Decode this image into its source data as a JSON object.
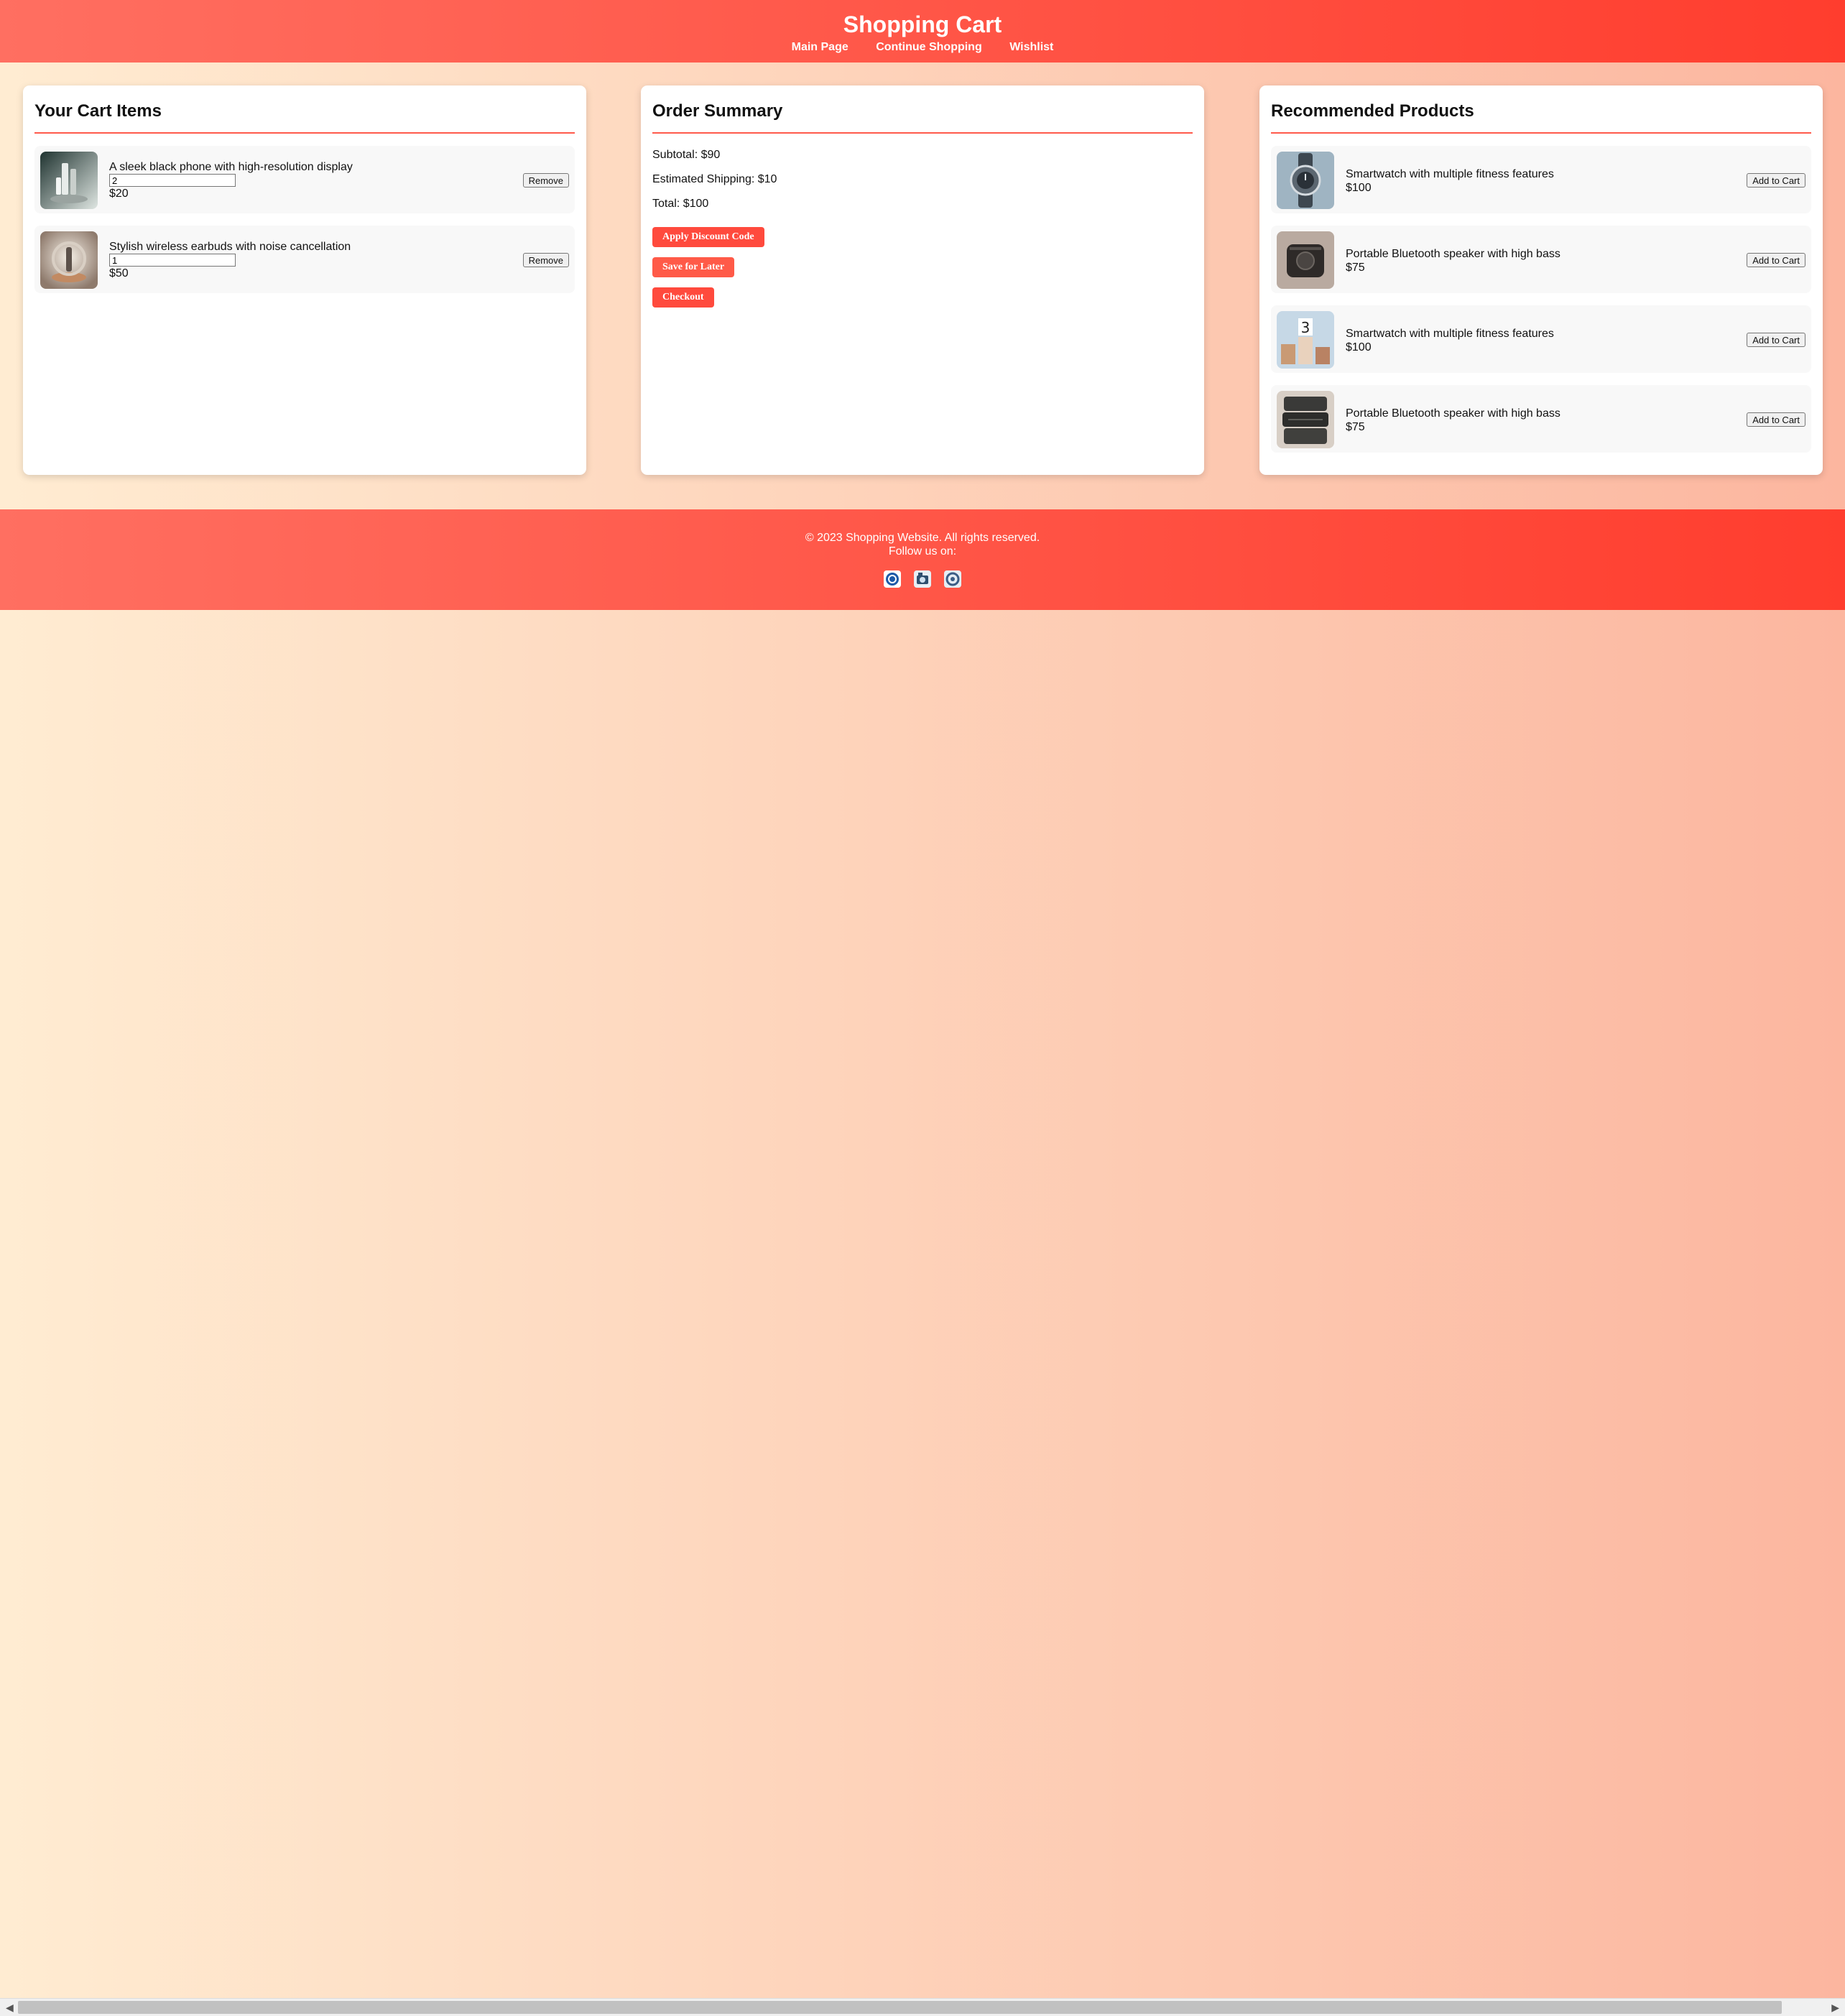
{
  "header": {
    "title": "Shopping Cart",
    "nav": [
      "Main Page",
      "Continue Shopping",
      "Wishlist"
    ]
  },
  "cart": {
    "heading": "Your Cart Items",
    "remove_label": "Remove",
    "items": [
      {
        "name": "A sleek black phone with high-resolution display",
        "quantity": "2",
        "price": "$20",
        "icon": "phone-image"
      },
      {
        "name": "Stylish wireless earbuds with noise cancellation",
        "quantity": "1",
        "price": "$50",
        "icon": "earbuds-image"
      }
    ]
  },
  "summary": {
    "heading": "Order Summary",
    "subtotal": "Subtotal: $90",
    "shipping": "Estimated Shipping: $10",
    "total": "Total: $100",
    "buttons": [
      "Apply Discount Code",
      "Save for Later",
      "Checkout"
    ]
  },
  "recommended": {
    "heading": "Recommended Products",
    "add_label": "Add to Cart",
    "items": [
      {
        "name": "Smartwatch with multiple fitness features",
        "price": "$100",
        "icon": "smartwatch-image"
      },
      {
        "name": "Portable Bluetooth speaker with high bass",
        "price": "$75",
        "icon": "speaker-image"
      },
      {
        "name": "Smartwatch with multiple fitness features",
        "price": "$100",
        "icon": "podium-image"
      },
      {
        "name": "Portable Bluetooth speaker with high bass",
        "price": "$75",
        "icon": "speaker-stack-image"
      }
    ]
  },
  "footer": {
    "copyright": "© 2023 Shopping Website. All rights reserved.",
    "follow": "Follow us on:",
    "social_icons": [
      "social-icon-1",
      "social-icon-2",
      "social-icon-3"
    ]
  },
  "colors": {
    "accent": "#ff4a3d",
    "header_gradient_start": "#ff6f61",
    "header_gradient_end": "#ff3d2e",
    "page_gradient_start": "#ffecd2",
    "page_gradient_end": "#fcb69f"
  }
}
